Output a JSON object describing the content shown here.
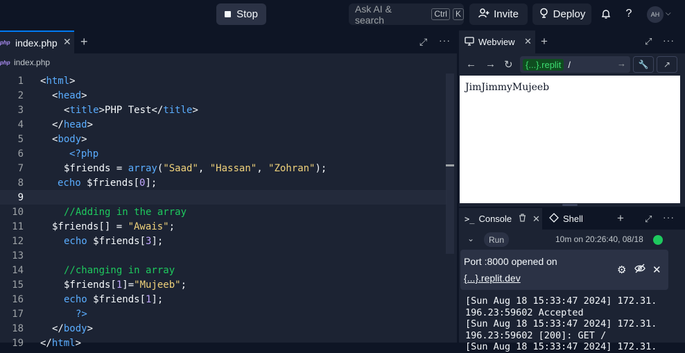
{
  "topbar": {
    "stop_label": "Stop",
    "search_label": "Ask AI & search",
    "search_kbd_1": "Ctrl",
    "search_kbd_2": "K",
    "invite_label": "Invite",
    "deploy_label": "Deploy",
    "avatar_initials": "AH"
  },
  "editor": {
    "tab_label": "index.php",
    "tab_file_type": "php",
    "breadcrumb_file_type": "php",
    "breadcrumb": "index.php",
    "lines": [
      {
        "n": "1"
      },
      {
        "n": "2"
      },
      {
        "n": "3"
      },
      {
        "n": "4"
      },
      {
        "n": "5"
      },
      {
        "n": "6"
      },
      {
        "n": "7"
      },
      {
        "n": "8"
      },
      {
        "n": "9"
      },
      {
        "n": "10"
      },
      {
        "n": "11"
      },
      {
        "n": "12"
      },
      {
        "n": "13"
      },
      {
        "n": "14"
      },
      {
        "n": "15"
      },
      {
        "n": "16"
      },
      {
        "n": "17"
      },
      {
        "n": "18"
      },
      {
        "n": "19"
      }
    ],
    "code": {
      "l1_open": "<",
      "l1_tag": "html",
      "l1_close": ">",
      "l2_open": "<",
      "l2_tag": "head",
      "l2_close": ">",
      "l3_open": "<",
      "l3_tag": "title",
      "l3_close": ">",
      "l3_text": "PHP Test",
      "l3_open2": "</",
      "l3_tag2": "title",
      "l3_close2": ">",
      "l4_open": "</",
      "l4_tag": "head",
      "l4_close": ">",
      "l5_open": "<",
      "l5_tag": "body",
      "l5_close": ">",
      "l6": "<?php",
      "l7_a": "$friends = ",
      "l7_fn": "array",
      "l7_b": "(",
      "l7_s1": "\"Saad\"",
      "l7_c1": ", ",
      "l7_s2": "\"Hassan\"",
      "l7_c2": ", ",
      "l7_s3": "\"Zohran\"",
      "l7_end": ");",
      "l8_a": "echo ",
      "l8_b": "$friends[",
      "l8_num": "0",
      "l8_end": "];",
      "l10": "//Adding in the array",
      "l11_a": "$friends[] = ",
      "l11_s": "\"Awais\"",
      "l11_end": ";",
      "l12_a": "echo ",
      "l12_b": "$friends[",
      "l12_num": "3",
      "l12_end": "];",
      "l14": "//changing in array",
      "l15_a": "$friends[",
      "l15_num": "1",
      "l15_b": "]=",
      "l15_s": "\"Mujeeb\"",
      "l15_end": ";",
      "l16_a": "echo ",
      "l16_b": "$friends[",
      "l16_num": "1",
      "l16_end": "];",
      "l17": "?>",
      "l18_open": "</",
      "l18_tag": "body",
      "l18_close": ">",
      "l19_open": "</",
      "l19_tag": "html",
      "l19_close": ">"
    }
  },
  "webview": {
    "tab_label": "Webview",
    "url_host": "{...}.replit",
    "url_path": "/",
    "content": "JimJimmyMujeeb"
  },
  "console": {
    "tab_label": "Console",
    "shell_label": "Shell",
    "run_label": "Run",
    "run_time": "10m on 20:26:40, 08/18",
    "port_text": "Port :8000 opened on",
    "port_link": "{...}.replit.dev",
    "log": "[Sun Aug 18 15:33:47 2024] 172.31.\n196.23:59602 Accepted\n[Sun Aug 18 15:33:47 2024] 172.31.\n196.23:59602 [200]: GET /\n[Sun Aug 18 15:33:47 2024] 172.31."
  },
  "colors": {
    "bg": "#0e1525",
    "panel": "#1c2333",
    "accent": "#0079f2",
    "status_running": "#1ec95e"
  }
}
